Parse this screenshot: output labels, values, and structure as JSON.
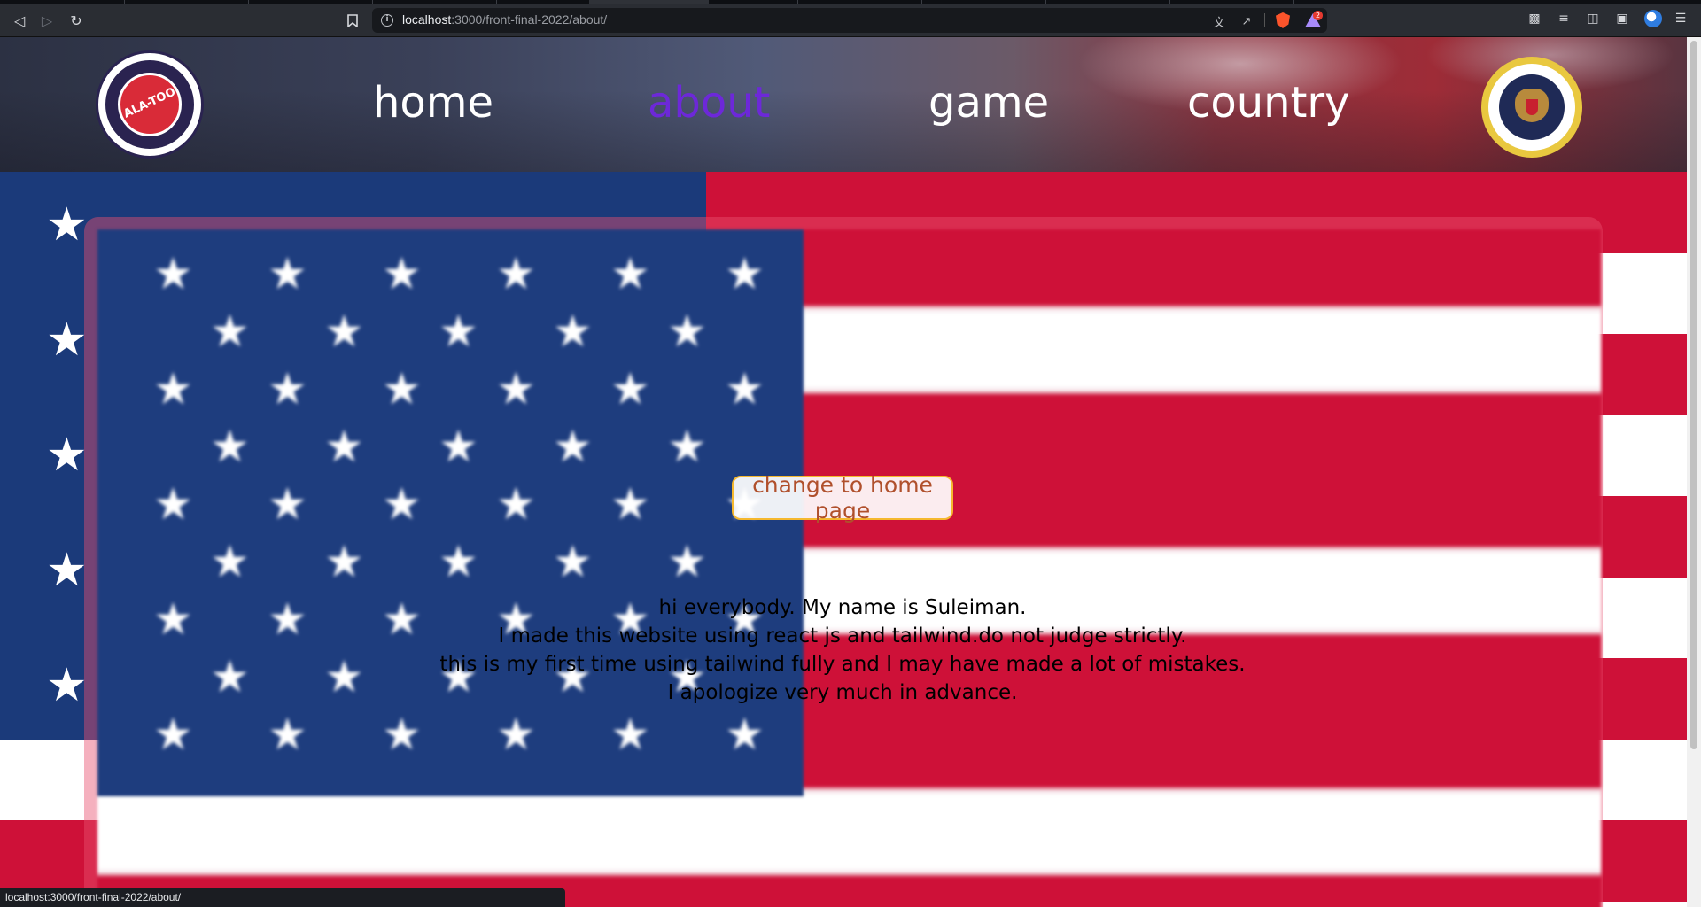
{
  "browser": {
    "url_host": "localhost",
    "url_path": ":3000/front-final-2022/about/",
    "rewards_badge": "2",
    "status_text": "localhost:3000/front-final-2022/about/"
  },
  "header": {
    "logo_text": "ALA-TOO",
    "nav": [
      {
        "label": "home"
      },
      {
        "label": "about",
        "active": true
      },
      {
        "label": "game"
      },
      {
        "label": "country"
      }
    ]
  },
  "main": {
    "button_label": "change to home page",
    "about_lines": [
      "hi everybody. My name is Suleiman.",
      "I made this website using react js and tailwind.do not judge strictly.",
      "this is my first time using tailwind fully and I may have made a lot of mistakes.",
      "I apologize very much in advance."
    ]
  },
  "colors": {
    "nav_active": "#6d28d9",
    "flag_red": "#ce1138",
    "flag_blue": "#1b3a7a",
    "button_border": "#f5b82e",
    "button_text": "#b0502c"
  },
  "icons": {
    "back": "arrow-left-icon",
    "forward": "arrow-right-icon",
    "reload": "reload-icon",
    "bookmark": "bookmark-icon",
    "site_info": "info-icon",
    "translate": "translate-icon",
    "share": "share-icon",
    "shields": "brave-shield-icon",
    "rewards": "brave-rewards-icon",
    "extensions": "puzzle-icon",
    "playlist": "playlist-icon",
    "sidebar": "sidebar-icon",
    "wallet": "wallet-icon",
    "profile": "profile-icon",
    "menu": "menu-icon"
  }
}
